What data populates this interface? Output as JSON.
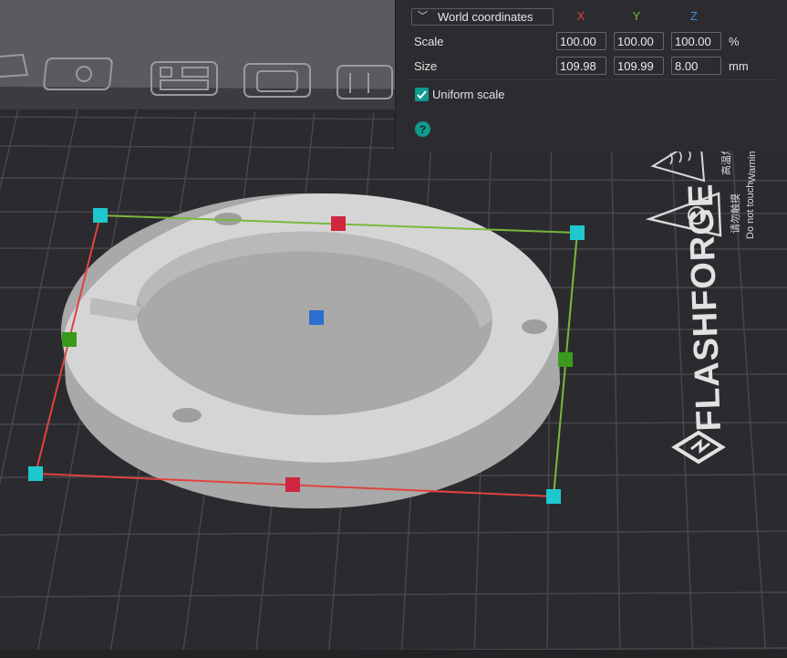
{
  "panel": {
    "coordinate_system": "World coordinates",
    "axes": {
      "x": "X",
      "y": "Y",
      "z": "Z"
    },
    "scale": {
      "label": "Scale",
      "x": "100.00",
      "y": "100.00",
      "z": "100.00",
      "unit": "%"
    },
    "size": {
      "label": "Size",
      "x": "109.98",
      "y": "109.99",
      "z": "8.00",
      "unit": "mm"
    },
    "uniform_scale": {
      "label": "Uniform scale",
      "checked": true
    },
    "help_label": "?"
  },
  "bed": {
    "brand": "FLASHFORGE",
    "warning_hot": "Warning surface",
    "warning_hot_cn": "高温危险",
    "warning_touch": "Do not touch",
    "warning_touch_cn": "请勿触摸"
  },
  "colors": {
    "accent": "#0f9b8e",
    "axis_x": "#e0433f",
    "axis_y": "#79b83d",
    "axis_z": "#3d8be0",
    "bed": "#2b2b2f",
    "grid": "#4a4a4e",
    "model": "#d5d5d5"
  }
}
